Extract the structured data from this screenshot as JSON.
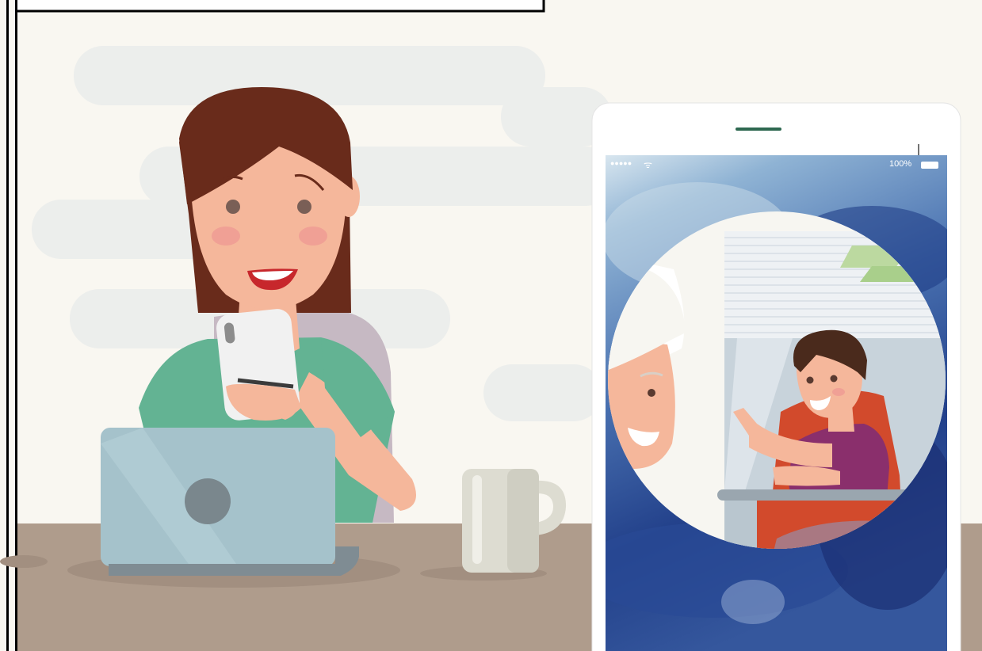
{
  "phone": {
    "status_bar": {
      "signal_dots": "●●●●●",
      "wifi_symbol": "ᯤ",
      "battery_label": "100%"
    }
  },
  "colors": {
    "background": "#f9f7f1",
    "cloud": "#eceeec",
    "desk": "#af9c8c",
    "hair_woman": "#692b1b",
    "skin": "#f5b79b",
    "shirt_woman": "#63b393",
    "chair": "#c6b9c3",
    "laptop": "#a5c2cb",
    "mug": "#dddcd1",
    "phone_screen": "#2e4b93",
    "phone_indicator": "#2e6850",
    "boy_shirt": "#8a2f6c",
    "boy_chair": "#d24a2c"
  }
}
